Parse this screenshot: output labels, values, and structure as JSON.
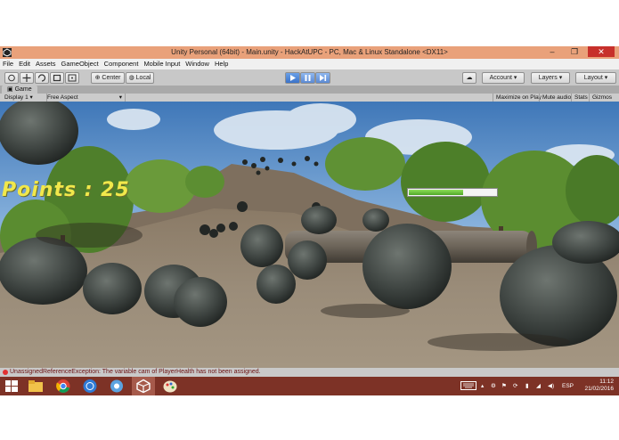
{
  "window": {
    "title": "Unity Personal (64bit) - Main.unity - HackAtUPC - PC, Mac & Linux Standalone <DX11>",
    "controls": [
      "–",
      "❐",
      "✕"
    ]
  },
  "menu": [
    "File",
    "Edit",
    "Assets",
    "GameObject",
    "Component",
    "Mobile Input",
    "Window",
    "Help"
  ],
  "toolbar": {
    "center_label": "Center",
    "local_label": "Local",
    "account_label": "Account",
    "layers_label": "Layers",
    "layout_label": "Layout"
  },
  "panel": {
    "tab_label": "Game"
  },
  "game_bar": {
    "display": "Display 1",
    "aspect": "Free Aspect",
    "maximize": "Maximize on Play",
    "mute": "Mute audio",
    "stats": "Stats",
    "gizmos": "Gizmos"
  },
  "hud": {
    "points_text": "Points : 25",
    "health_fraction": 0.62
  },
  "status": {
    "message": "UnassignedReferenceException: The variable cam of PlayerHealth has not been assigned."
  },
  "taskbar": {
    "language": "ESP",
    "time": "11:12",
    "date": "21/02/2016"
  },
  "colors": {
    "titlebar": "#e9a17a",
    "taskbar": "#7d3226",
    "points_text": "#f1e84b",
    "health_fill": "#5cb832"
  }
}
